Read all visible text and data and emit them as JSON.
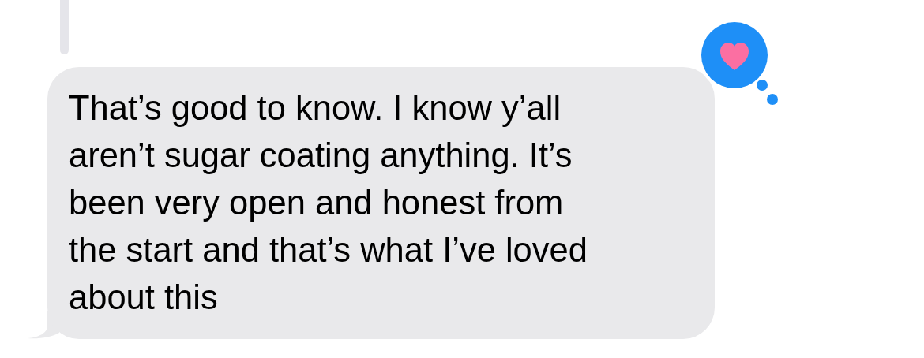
{
  "message": {
    "lines": [
      "That’s good to know. I know y’all",
      "aren’t sugar coating anything. It’s",
      "been very open and honest from",
      "the start and that’s what I’ve loved",
      "about this"
    ]
  },
  "reaction": {
    "kind": "heart"
  }
}
